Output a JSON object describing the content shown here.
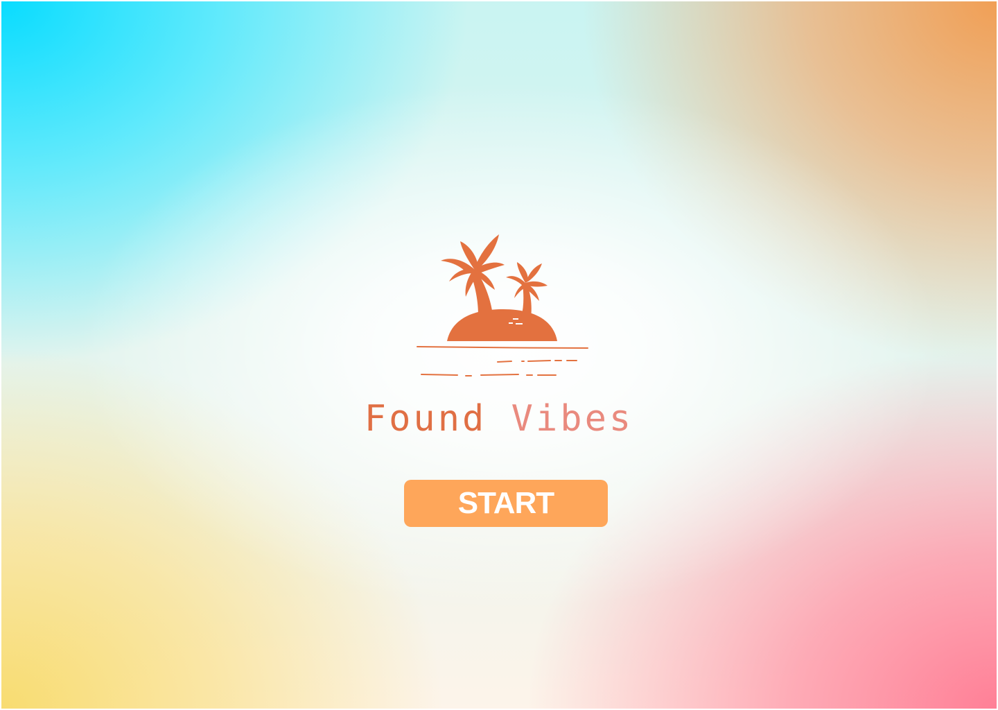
{
  "app": {
    "title_word_1": "Found",
    "title_word_2": "Vibes",
    "logo_icon": "palm-island-icon"
  },
  "actions": {
    "start_label": "START"
  },
  "colors": {
    "logo": "#e3713f",
    "title_primary": "#e06f44",
    "title_secondary": "#e98a7e",
    "button": "#fea65a",
    "button_text": "#ffffff",
    "gradient_top_left": "#08dcff",
    "gradient_top_right": "#f19f55",
    "gradient_bottom_left": "#f8dc70",
    "gradient_bottom_right": "#ff7f96"
  }
}
